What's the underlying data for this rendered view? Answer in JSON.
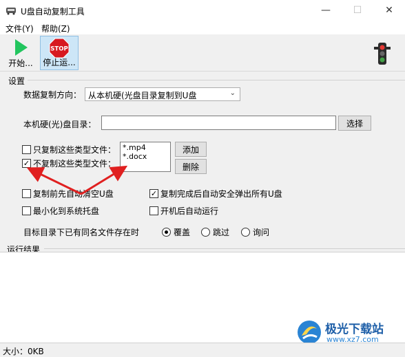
{
  "window": {
    "title": "U盘自动复制工具",
    "min": "—",
    "max": "☐",
    "close": "✕"
  },
  "menu": [
    "文件(Y)",
    "帮助(Z)"
  ],
  "toolbar": {
    "start_label": "开始...",
    "stop_label": "停止运...",
    "stop_sign_text": "STOP"
  },
  "settings": {
    "group_label": "设置",
    "direction_label": "数据复制方向：",
    "direction_value": "从本机硬(光盘目录复制到U盘",
    "dir_label": "本机硬(光)盘目录：",
    "dir_value": "",
    "browse": "选择",
    "only_copy": "只复制这些类型文件：",
    "no_copy": "不复制这些类型文件：",
    "filetypes": [
      "*.mp4",
      "*.docx"
    ],
    "add": "添加",
    "delete": "删除",
    "clear_before": "复制前先自动清空U盘",
    "eject_after": "复制完成后自动安全弹出所有U盘",
    "minimize_tray": "最小化到系统托盘",
    "autorun": "开机后自动运行",
    "conflict_label": "目标目录下已有同名文件存在时",
    "opt_overwrite": "覆盖",
    "opt_skip": "跳过",
    "opt_ask": "询问",
    "only_copy_checked": false,
    "no_copy_checked": true,
    "clear_checked": false,
    "eject_checked": true,
    "minimize_checked": false,
    "autorun_checked": false
  },
  "result": {
    "group_label": "运行结果"
  },
  "status": {
    "size": "大小：0KB"
  },
  "watermark": {
    "site_name": "极光下载站",
    "url": "www.xz7.com"
  },
  "colors": {
    "play": "#22c55e",
    "stop": "#d71920",
    "arrow": "#e02020",
    "accent": "#cde6f7"
  }
}
